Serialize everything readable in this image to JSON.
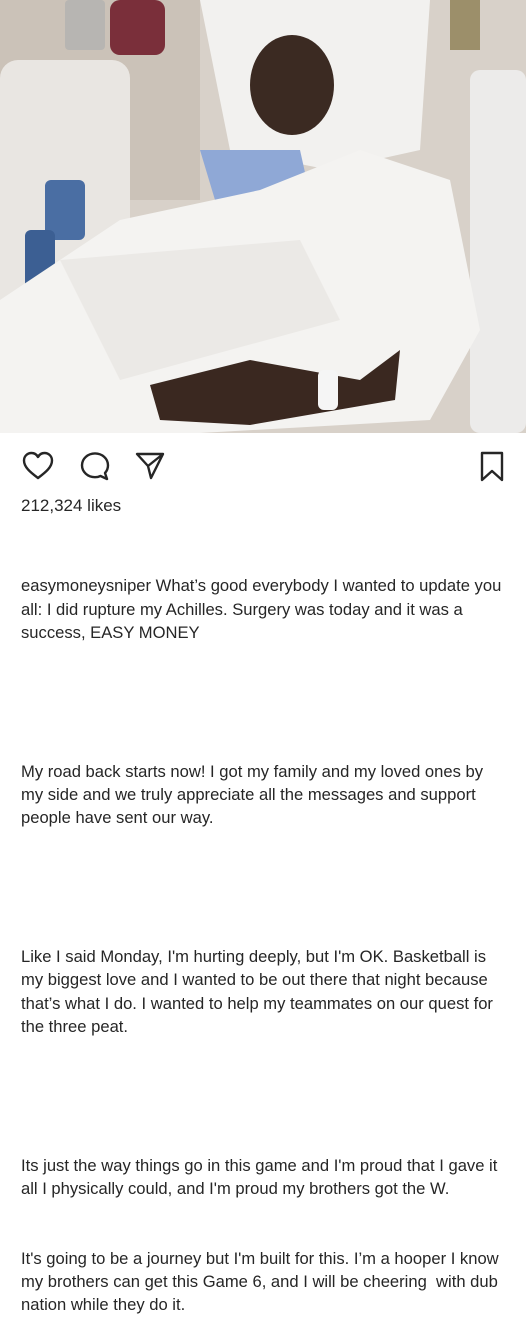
{
  "post": {
    "likes": "212,324 likes",
    "username": "easymoneysniper",
    "caption_first": " What’s good everybody I wanted to update you all: I did rupture my Achilles. Surgery was today and it was a success, EASY MONEY",
    "paragraphs": [
      "My road back starts now! I got my family and my loved ones by my side and we truly appreciate all the messages and support people have sent our way.",
      "Like I said Monday, I'm hurting deeply, but I'm OK. Basketball is my biggest love and I wanted to be out there that night because that’s what I do. I wanted to help my teammates on our quest for the three peat.",
      "Its just the way things go in this game and I'm proud that I gave it all I physically could, and I'm proud my brothers got the W.",
      "It's going to be a journey but I'm built for this. I’m a hooper I know my brothers can get this Game 6, and I will be cheering  with dub nation while they do it."
    ]
  },
  "icons": {
    "like": "heart-icon",
    "comment": "comment-icon",
    "share": "share-icon",
    "save": "bookmark-icon"
  },
  "colors": {
    "text": "#262626",
    "icon": "#262626"
  }
}
